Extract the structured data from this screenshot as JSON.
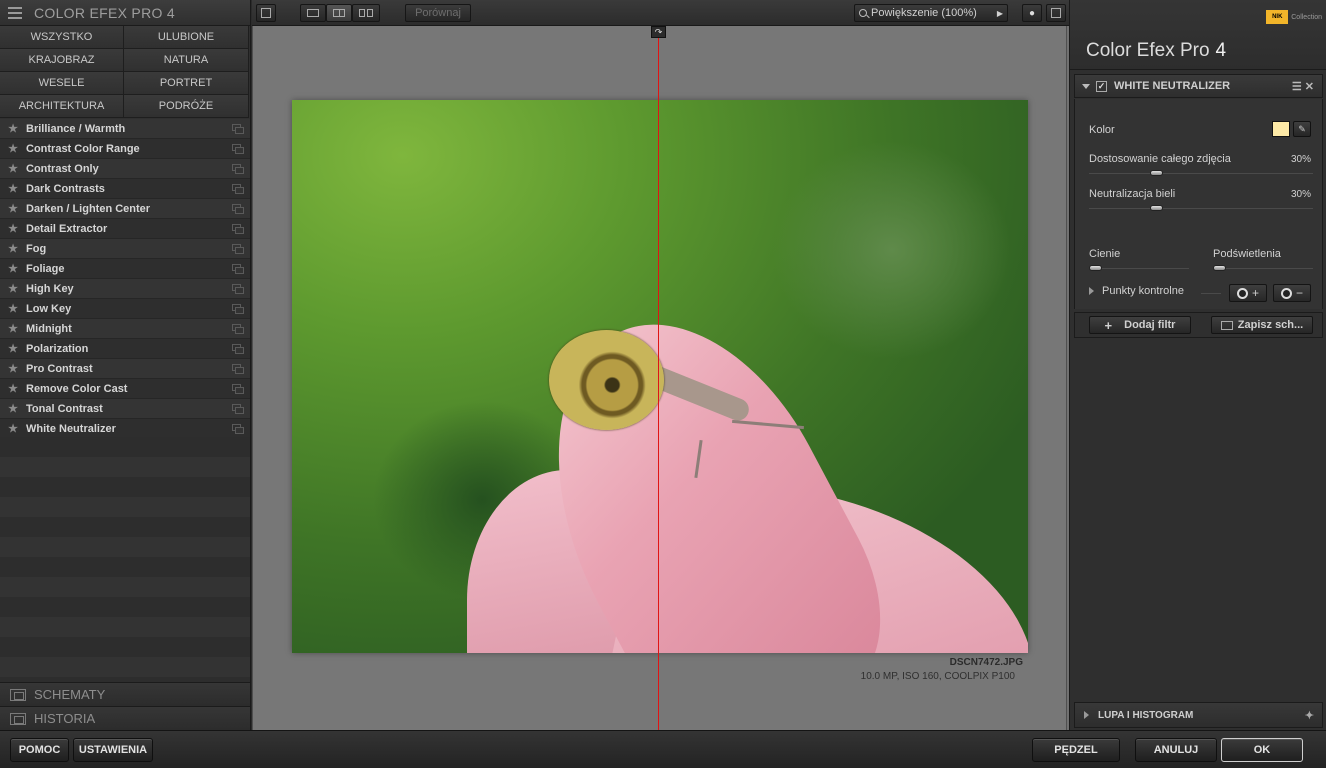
{
  "left_panel": {
    "title": "COLOR EFEX PRO 4",
    "categories": [
      "WSZYSTKO",
      "ULUBIONE",
      "KRAJOBRAZ",
      "NATURA",
      "WESELE",
      "PORTRET",
      "ARCHITEKTURA",
      "PODRÓŻE"
    ],
    "filters": [
      "Brilliance / Warmth",
      "Contrast Color Range",
      "Contrast Only",
      "Dark Contrasts",
      "Darken / Lighten Center",
      "Detail Extractor",
      "Fog",
      "Foliage",
      "High Key",
      "Low Key",
      "Midnight",
      "Polarization",
      "Pro Contrast",
      "Remove Color Cast",
      "Tonal Contrast",
      "White Neutralizer"
    ],
    "sections": {
      "presets": "SCHEMATY",
      "history": "HISTORIA"
    }
  },
  "toolbar": {
    "compare_label": "Porównaj",
    "zoom_label": "Powiększenie (100%)"
  },
  "canvas": {
    "file_name": "DSCN7472.JPG",
    "file_info": "10.0 MP, ISO 160, COOLPIX P100"
  },
  "right_panel": {
    "title": "Color Efex Pro",
    "version": "4",
    "logo_mark": "NIK",
    "logo_text": "Collection",
    "filter_name": "WHITE NEUTRALIZER",
    "controls": {
      "color_label": "Kolor",
      "color_value": "#fde9a6",
      "global_label": "Dostosowanie całego zdjęcia",
      "global_value": "30%",
      "global_level": 30,
      "white_label": "Neutralizacja bieli",
      "white_value": "30%",
      "white_level": 30,
      "shadows_label": "Cienie",
      "highlights_label": "Podświetlenia",
      "control_points_label": "Punkty kontrolne"
    },
    "add_filter": "Dodaj filtr",
    "save_preset": "Zapisz sch...",
    "loupe_label": "LUPA I HISTOGRAM"
  },
  "bottom_bar": {
    "help": "POMOC",
    "settings": "USTAWIENIA",
    "brush": "PĘDZEL",
    "cancel": "ANULUJ",
    "ok": "OK"
  }
}
